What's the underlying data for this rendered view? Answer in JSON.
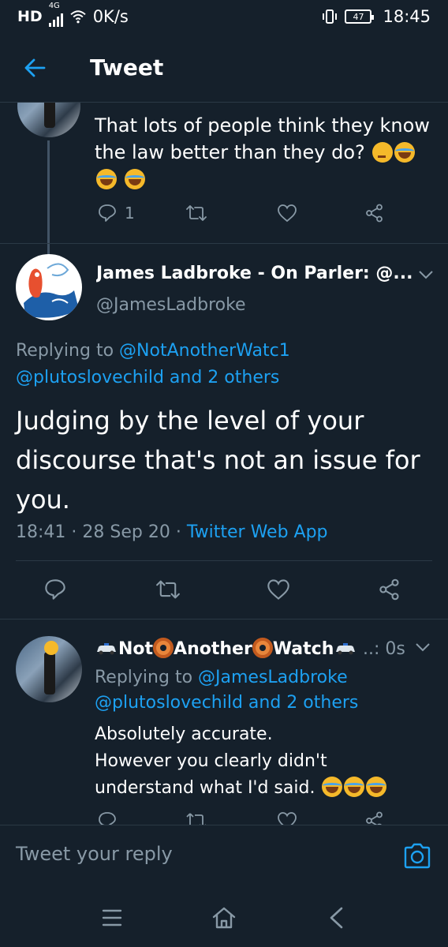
{
  "status": {
    "hd": "HD",
    "network": "4G",
    "speed": "0K/s",
    "battery": "47",
    "time": "18:45"
  },
  "header": {
    "title": "Tweet"
  },
  "prev_tweet": {
    "text": "That lots of people think they know the law better than they do?",
    "reply_count": "1"
  },
  "main_tweet": {
    "name": "James Ladbroke - On Parler: @...",
    "handle": "@JamesLadbroke",
    "replying_prefix": "Replying to",
    "replying_user": "@NotAnotherWatc1",
    "replying_rest": "@plutoslovechild and 2 others",
    "body": "Judging by the level of your discourse that's not an issue for you.",
    "time": "18:41",
    "date": "28 Sep 20",
    "source": "Twitter Web App"
  },
  "reply_tweet": {
    "name_part1": "Not",
    "name_part2": "Another",
    "name_part3": "Watch",
    "time_suffix": "..: 0s",
    "replying_prefix": "Replying to",
    "replying_user": "@JamesLadbroke",
    "replying_rest": "@plutoslovechild and 2 others",
    "line1": "Absolutely accurate.",
    "line2": "However you clearly didn't",
    "line3": "understand what I'd said."
  },
  "reply_bar": {
    "placeholder": "Tweet your reply"
  },
  "colors": {
    "accent": "#1da1f2",
    "background": "#15202b",
    "muted": "#8899a6"
  }
}
